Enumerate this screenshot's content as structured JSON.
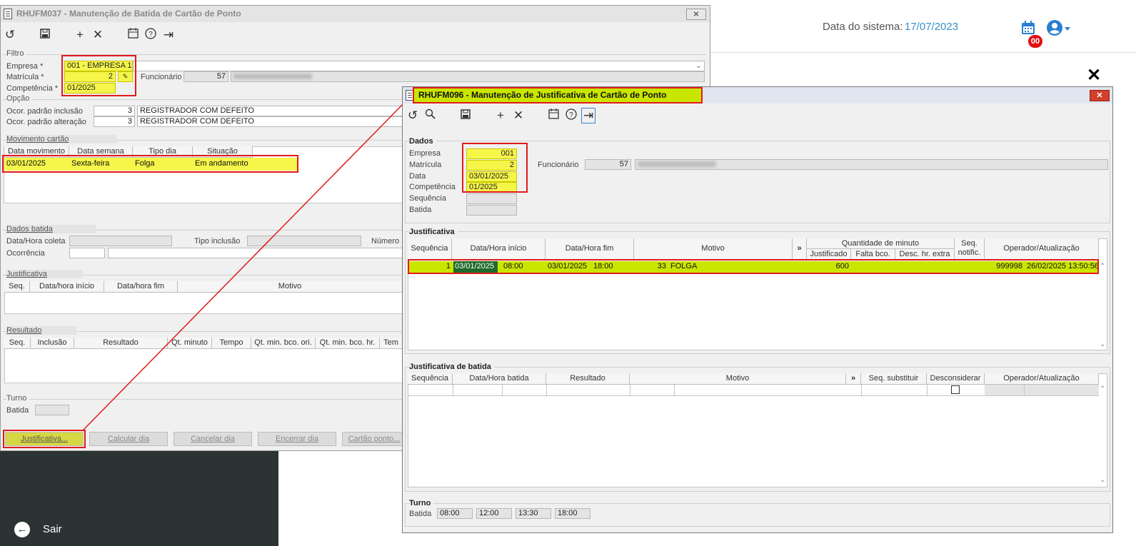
{
  "header": {
    "date_label": "Data do sistema:",
    "date_value": "17/07/2023",
    "badge": "00"
  },
  "sidebar": {
    "exit_label": "Sair"
  },
  "w1": {
    "title": "RHUFM037 - Manutenção de Batida de Cartão de Ponto",
    "close": "⨯",
    "filtro": {
      "title": "Filtro",
      "empresa_label": "Empresa *",
      "empresa_value": "001 - EMPRESA 1",
      "matricula_label": "Matrícula *",
      "matricula_value": "2",
      "competencia_label": "Competência *",
      "competencia_value": "01/2025",
      "funcionario_label": "Funcionário",
      "funcionario_value": "57"
    },
    "opcao": {
      "title": "Opção",
      "inclusao_label": "Ocor. padrão inclusão",
      "inclusao_code": "3",
      "inclusao_desc": "REGISTRADOR COM DEFEITO",
      "alteracao_label": "Ocor. padrão alteração",
      "alteracao_code": "3",
      "alteracao_desc": "REGISTRADOR COM DEFEITO"
    },
    "movimento": {
      "title": "Movimento cartão",
      "columns": [
        "Data movimento",
        "Data semana",
        "Tipo dia",
        "Situação"
      ],
      "row": [
        "03/01/2025",
        "Sexta-feira",
        "Folga",
        "Em andamento"
      ]
    },
    "dados_batida": {
      "title": "Dados batida",
      "datahora_label": "Data/Hora coleta",
      "tipo_label": "Tipo inclusão",
      "numero_label": "Número R",
      "ocorrencia_label": "Ocorrência"
    },
    "justificativa": {
      "title": "Justificativa",
      "columns": [
        "Seq.",
        "Data/hora início",
        "Data/hora fim",
        "Motivo"
      ]
    },
    "resultado": {
      "title": "Resultado",
      "columns": [
        "Seq.",
        "Inclusão",
        "Resultado",
        "Qt. minuto",
        "Tempo",
        "Qt. min. bco. ori.",
        "Qt. min. bco. hr.",
        "Tem"
      ]
    },
    "turno": {
      "title": "Turno",
      "batida_label": "Batida"
    },
    "buttons": [
      "Justificativa...",
      "Calcular dia",
      "Cancelar dia",
      "Encerrar dia",
      "Cartão ponto..."
    ]
  },
  "w2": {
    "title": "RHUFM096 - Manutenção de Justificativa de Cartão de Ponto",
    "close": "✕",
    "dados": {
      "title": "Dados",
      "empresa_label": "Empresa",
      "empresa_value": "001",
      "matricula_label": "Matrícula",
      "matricula_value": "2",
      "data_label": "Data",
      "data_value": "03/01/2025",
      "competencia_label": "Competência",
      "competencia_value": "01/2025",
      "sequencia_label": "Sequência",
      "batida_label": "Batida",
      "funcionario_label": "Funcionário",
      "funcionario_value": "57"
    },
    "justificativa": {
      "title": "Justificativa",
      "columns": {
        "sequencia": "Sequência",
        "inicio": "Data/Hora início",
        "fim": "Data/Hora fim",
        "motivo": "Motivo",
        "more": "»",
        "qtd": "Quantidade de minuto",
        "justificado": "Justificado",
        "falta": "Falta bco.",
        "desc": "Desc. hr. extra",
        "seq_notif": "Seq. notific.",
        "operador": "Operador/Atualização"
      },
      "row": {
        "seq": "1",
        "ini_date": "03/01/2025",
        "ini_time": "08:00",
        "fim_date": "03/01/2025",
        "fim_time": "18:00",
        "motivo_code": "33",
        "motivo_desc": "FOLGA",
        "justificado": "600",
        "operador": "999998",
        "atualizacao": "26/02/2025 13:50:56"
      }
    },
    "just_batida": {
      "title": "Justificativa de batida",
      "columns": {
        "sequencia": "Sequência",
        "datahora": "Data/Hora batida",
        "resultado": "Resultado",
        "motivo": "Motivo",
        "more": "»",
        "seq_sub": "Seq. substituir",
        "desconsiderar": "Desconsiderar",
        "operador": "Operador/Atualização"
      }
    },
    "turno": {
      "title": "Turno",
      "batida_label": "Batida",
      "times": [
        "08:00",
        "12:00",
        "13:30",
        "18:00"
      ]
    }
  }
}
